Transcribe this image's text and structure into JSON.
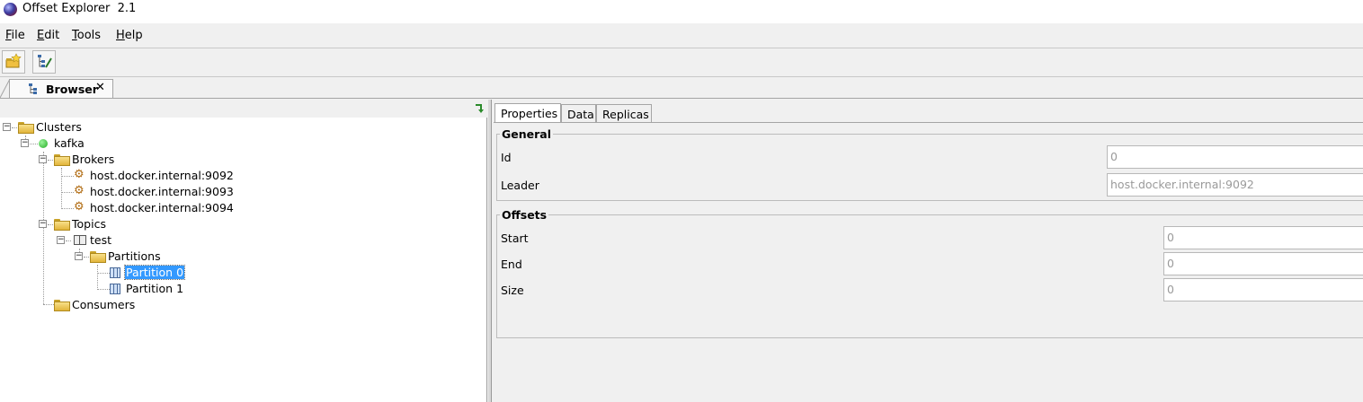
{
  "window": {
    "title": "Offset Explorer  2.1"
  },
  "menu": [
    "File",
    "Edit",
    "Tools",
    "Help"
  ],
  "toolbar": {
    "buttons": [
      "add-cluster-icon",
      "tree-edit-icon"
    ]
  },
  "tabs": {
    "browser": {
      "label": "Browser",
      "close": "✕"
    }
  },
  "tree": {
    "clusters": "Clusters",
    "cluster": "kafka",
    "brokers": "Brokers",
    "broker_items": [
      "host.docker.internal:9092",
      "host.docker.internal:9093",
      "host.docker.internal:9094"
    ],
    "topics": "Topics",
    "topic": "test",
    "partitions": "Partitions",
    "partition_items": [
      "Partition 0",
      "Partition 1"
    ],
    "consumers": "Consumers"
  },
  "detail": {
    "tabs": [
      "Properties",
      "Data",
      "Replicas"
    ],
    "general": {
      "title": "General",
      "id_label": "Id",
      "id_value": "0",
      "leader_label": "Leader",
      "leader_value": "host.docker.internal:9092"
    },
    "offsets": {
      "title": "Offsets",
      "start_label": "Start",
      "start_value": "0",
      "end_label": "End",
      "end_value": "0",
      "size_label": "Size",
      "size_value": "0"
    }
  },
  "colors": {
    "selection": "#3399ff",
    "folder": "#e2b53b",
    "status_online": "#22aa22"
  }
}
